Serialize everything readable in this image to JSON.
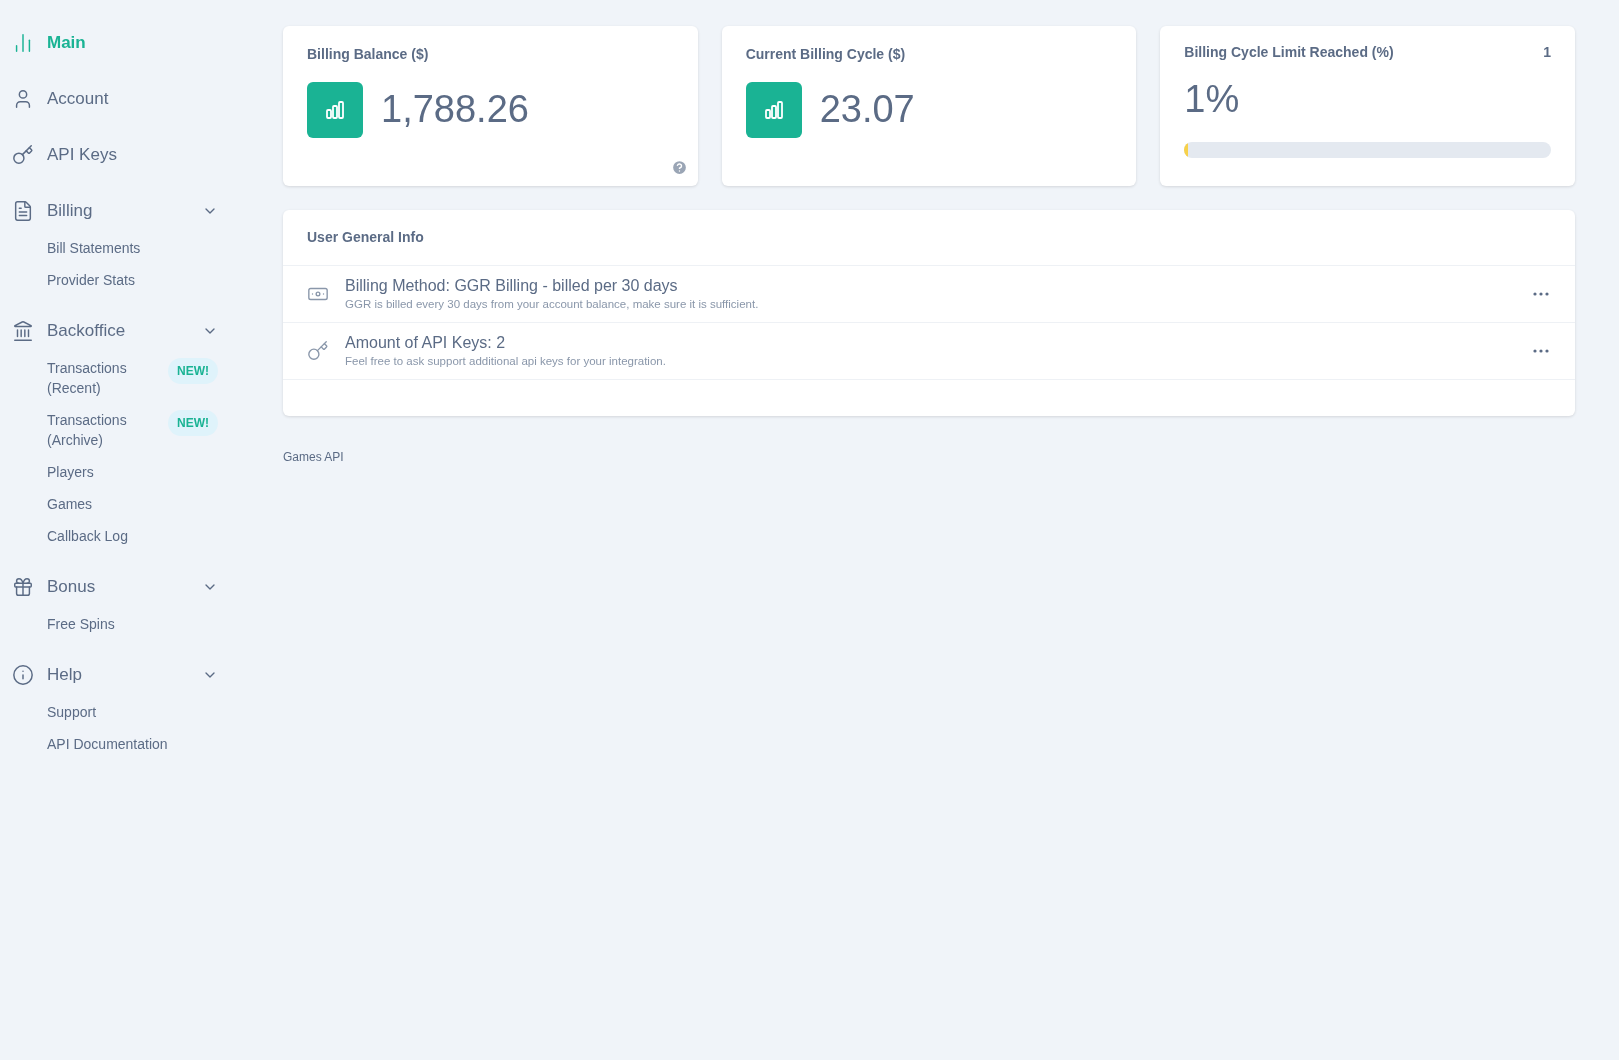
{
  "sidebar": {
    "items": [
      {
        "label": "Main",
        "selected": true
      },
      {
        "label": "Account",
        "selected": false
      },
      {
        "label": "API Keys",
        "selected": false
      },
      {
        "label": "Billing",
        "selected": false,
        "expanded": true,
        "children": [
          {
            "label": "Bill Statements",
            "selected": false
          },
          {
            "label": "Provider Stats",
            "selected": false
          }
        ]
      },
      {
        "label": "Backoffice",
        "selected": false,
        "expanded": true,
        "children": [
          {
            "label": "Transactions (Recent)",
            "selected": false,
            "badge": "NEW!"
          },
          {
            "label": "Transactions (Archive)",
            "selected": false,
            "badge": "NEW!"
          },
          {
            "label": "Players",
            "selected": false
          },
          {
            "label": "Games",
            "selected": false
          },
          {
            "label": "Callback Log",
            "selected": false
          }
        ]
      },
      {
        "label": "Bonus",
        "selected": false,
        "expanded": true,
        "children": [
          {
            "label": "Free Spins",
            "selected": false
          }
        ]
      },
      {
        "label": "Help",
        "selected": false,
        "expanded": true,
        "children": [
          {
            "label": "Support",
            "selected": false
          },
          {
            "label": "API Documentation",
            "selected": false
          }
        ]
      }
    ]
  },
  "cards": [
    {
      "kind": "stat",
      "title": "Billing Balance ($)",
      "value": "1,788.26",
      "help": true
    },
    {
      "kind": "stat",
      "title": "Current Billing Cycle ($)",
      "value": "23.07",
      "help": false
    },
    {
      "kind": "progress",
      "title": "Billing Cycle Limit Reached (%)",
      "count": "1",
      "value": "1%",
      "level": 0.01
    }
  ],
  "info": {
    "title": "User General Info",
    "rows": [
      {
        "title": "Billing Method: GGR Billing - billed per 30 days",
        "description": "GGR is billed every 30 days from your account balance, make sure it is sufficient."
      },
      {
        "title": "Amount of API Keys: 2",
        "description": "Feel free to ask support additional api keys for your integration."
      }
    ]
  },
  "footer": "Games API"
}
